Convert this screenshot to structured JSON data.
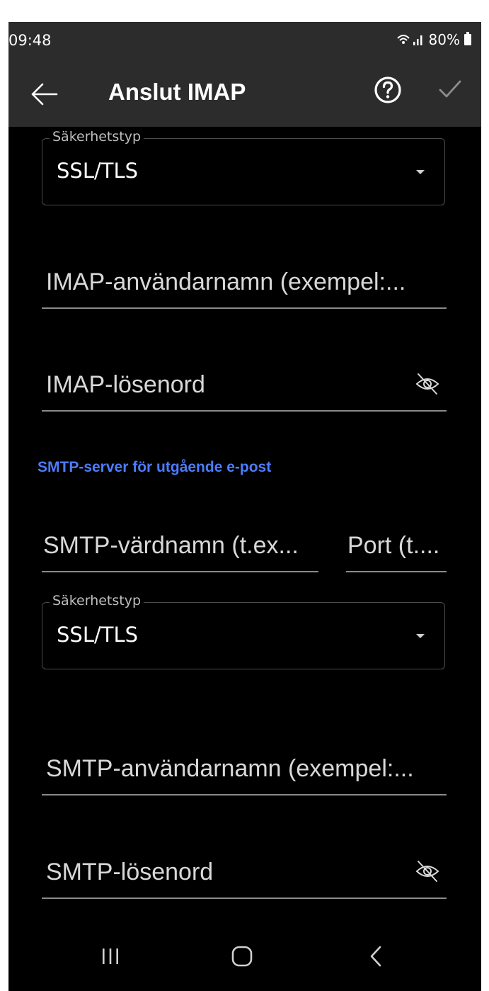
{
  "status_bar": {
    "time": "09:48",
    "battery_text": "80%"
  },
  "app_bar": {
    "title": "Anslut IMAP",
    "back_icon": "arrow-left-icon",
    "help_icon": "question-circle-icon",
    "confirm_icon": "check-icon"
  },
  "imap": {
    "security": {
      "label": "Säkerhetstyp",
      "value": "SSL/TLS"
    },
    "username": {
      "placeholder": "IMAP-användarnamn (exempel:..."
    },
    "password": {
      "placeholder": "IMAP-lösenord"
    }
  },
  "smtp": {
    "section_title": "SMTP-server för utgående e-post",
    "hostname": {
      "placeholder": "SMTP-värdnamn (t.ex..."
    },
    "port": {
      "placeholder": "Port (t...."
    },
    "security": {
      "label": "Säkerhetstyp",
      "value": "SSL/TLS"
    },
    "username": {
      "placeholder": "SMTP-användarnamn (exempel:..."
    },
    "password": {
      "placeholder": "SMTP-lösenord"
    }
  },
  "colors": {
    "app_bar_bg": "#2c2c2c",
    "background": "#000000",
    "accent": "#4d7cfe",
    "text": "#ffffff"
  },
  "nav_bar": {
    "recents_icon": "recents-icon",
    "home_icon": "home-icon",
    "back_icon": "nav-back-icon"
  }
}
